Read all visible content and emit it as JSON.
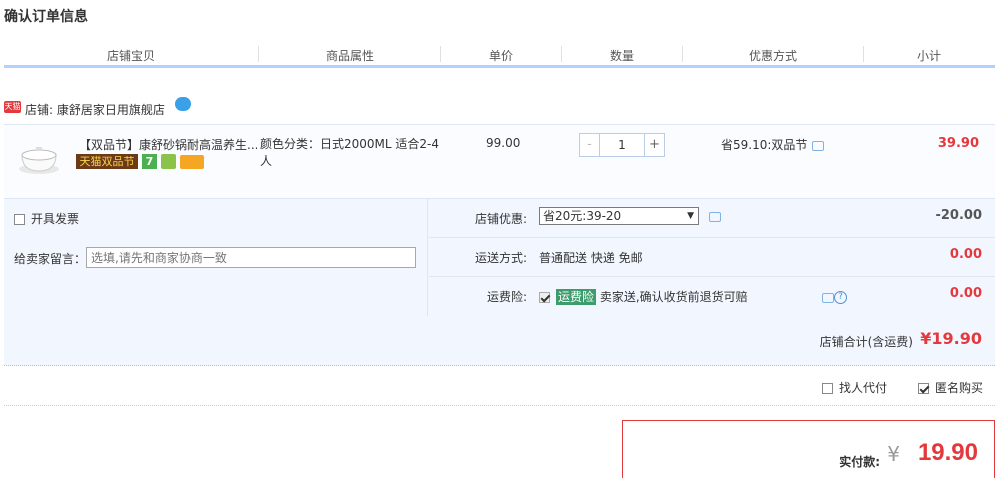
{
  "page_title": "确认订单信息",
  "columns": [
    "店铺宝贝",
    "商品属性",
    "单价",
    "数量",
    "优惠方式",
    "小计"
  ],
  "shop": {
    "badge": "天猫",
    "label": "店铺: 康舒居家日用旗舰店"
  },
  "item": {
    "title": "【双品节】康舒砂锅耐高温养生...",
    "tag_promo": "天猫双品节",
    "tag_seven": "7",
    "attr": "颜色分类：日式2000ML 适合2-4人",
    "price": "99.00",
    "qty_minus": "-",
    "qty": "1",
    "qty_plus": "+",
    "discount": "省59.10:双品节",
    "subtotal": "39.90"
  },
  "invoice_label": "开具发票",
  "memo": {
    "label": "给卖家留言：",
    "placeholder": "选填,请先和商家协商一致"
  },
  "shop_coupon": {
    "label": "店铺优惠:",
    "selected": "省20元:39-20",
    "amount": "-20.00",
    "amount_color": "#555555"
  },
  "shipping": {
    "label": "运送方式:",
    "value": "普通配送 快递 免邮",
    "amount": "0.00"
  },
  "insurance": {
    "label": "运费险:",
    "tag": "运费险",
    "value": "卖家送,确认收货前退货可赔",
    "amount": "0.00"
  },
  "shop_total": {
    "label": "店铺合计(含运费)",
    "amount": "¥19.90"
  },
  "extras": {
    "proxy_label": "找人代付",
    "proxy_checked": false,
    "anon_label": "匿名购买",
    "anon_checked": true
  },
  "payment": {
    "label": "实付款:",
    "currency": "¥",
    "amount": "19.90"
  },
  "colors": {
    "accent_red": "#e4393c",
    "header_line": "#b2d1ff",
    "panel_bg": "#f2f7ff"
  }
}
